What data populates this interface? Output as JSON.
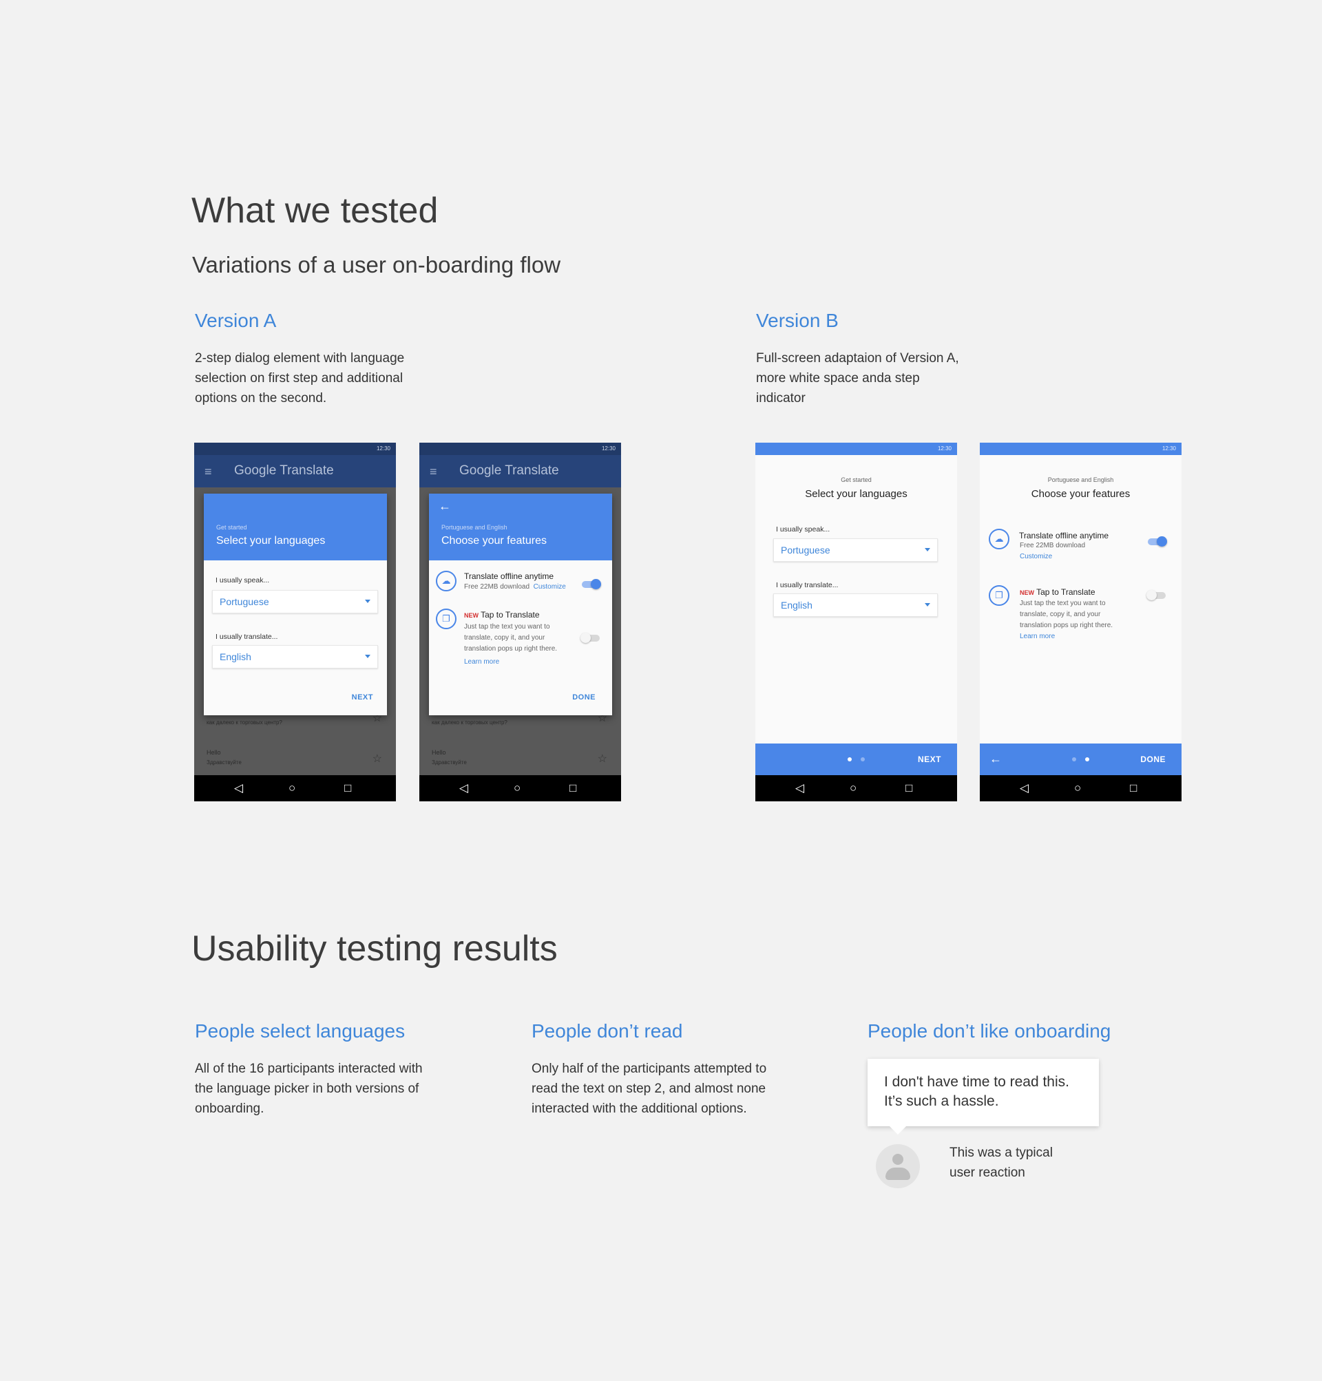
{
  "tested": {
    "heading": "What we tested",
    "subheading": "Variations of a user on-boarding flow",
    "version_a": {
      "title": "Version A",
      "description_lines": [
        "2-step dialog element with language",
        "selection on first step and additional",
        "options on the second."
      ]
    },
    "version_b": {
      "title": "Version B",
      "description_lines": [
        "Full-screen adaptaion of Version A,",
        "more white space anda step",
        "indicator"
      ]
    }
  },
  "phone_common": {
    "status_time_a": "12:30",
    "status_time_b": "12:30",
    "brand": "Google Translate",
    "menu_icon": "≡",
    "history": [
      {
        "text": "как далеко к торговых центр?"
      },
      {
        "text": "Hello"
      },
      {
        "text": "Здравствуйте"
      }
    ]
  },
  "step1": {
    "small": "Get started",
    "title": "Select your languages",
    "speak_label": "I usually speak...",
    "speak_value": "Portuguese",
    "translate_label": "I usually translate...",
    "translate_value": "English",
    "next": "NEXT"
  },
  "step2": {
    "small": "Portuguese and English",
    "title": "Choose your features",
    "offline_title": "Translate offline anytime",
    "offline_sub": "Free 22MB download",
    "customize": "Customize",
    "new_badge": "NEW",
    "tap_title": "Tap to Translate",
    "tap_desc_a": [
      "Just tap the text you want to",
      "translate, copy it, and your",
      "translation pops up right there."
    ],
    "tap_desc_b": [
      "Just tap the text you want to",
      "translate, copy it, and your",
      "translation pops up right there."
    ],
    "learn_more": "Learn more",
    "done": "DONE",
    "offline_enabled": true,
    "tap_enabled": false
  },
  "results": {
    "heading": "Usability testing results",
    "col1": {
      "title": "People select languages",
      "lines": [
        "All of the 16 participants interacted with",
        "the language picker in both versions of",
        "onboarding."
      ]
    },
    "col2": {
      "title": "People don’t read",
      "lines": [
        "Only half of the participants attempted to",
        "read the text on step 2, and almost none",
        "interacted with the additional options."
      ]
    },
    "col3": {
      "title": "People don’t like onboarding",
      "quote_lines": [
        "I don't have time to read this.",
        "It’s such a hassle."
      ],
      "caption_lines": [
        "This was a typical",
        "user reaction"
      ]
    }
  },
  "colors": {
    "accent": "#3f86d9",
    "primary": "#4a86e8",
    "appbar": "#27447a",
    "background": "#f2f2f2"
  }
}
